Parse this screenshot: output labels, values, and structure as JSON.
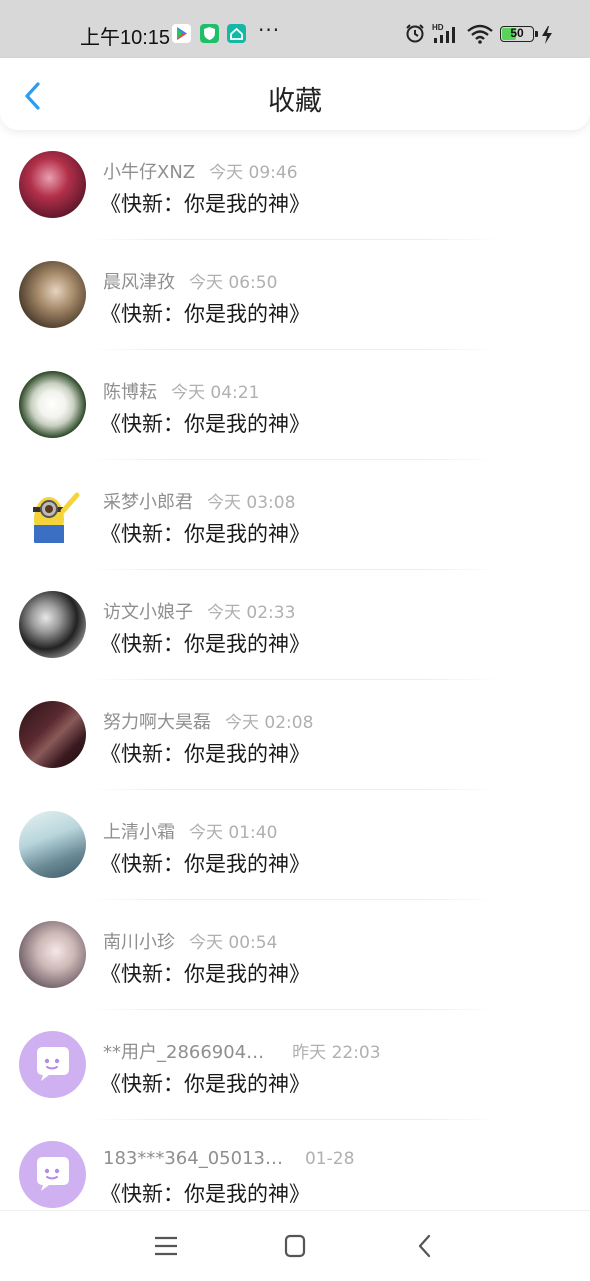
{
  "status_bar": {
    "time": "上午10:15",
    "more_dots": "···",
    "battery_level": "50",
    "battery_percent": 50
  },
  "header": {
    "title": "收藏",
    "back_icon": "chevron-left-icon"
  },
  "favorites": [
    {
      "user": "小牛仔XNZ",
      "time": "今天 09:46",
      "content": "《快新：你是我的神》",
      "avatar": "avatar-photo-red"
    },
    {
      "user": "晨风津孜",
      "time": "今天 06:50",
      "content": "《快新：你是我的神》",
      "avatar": "avatar-photo-girl"
    },
    {
      "user": "陈博耘",
      "time": "今天 04:21",
      "content": "《快新：你是我的神》",
      "avatar": "avatar-photo-flower"
    },
    {
      "user": "采梦小郎君",
      "time": "今天 03:08",
      "content": "《快新：你是我的神》",
      "avatar": "avatar-photo-minion"
    },
    {
      "user": "访文小娘子",
      "time": "今天 02:33",
      "content": "《快新：你是我的神》",
      "avatar": "avatar-photo-bw"
    },
    {
      "user": "努力啊大昊磊",
      "time": "今天 02:08",
      "content": "《快新：你是我的神》",
      "avatar": "avatar-photo-dark"
    },
    {
      "user": "上清小霜",
      "time": "今天 01:40",
      "content": "《快新：你是我的神》",
      "avatar": "avatar-photo-sky"
    },
    {
      "user": "南川小珍",
      "time": "今天 00:54",
      "content": "《快新：你是我的神》",
      "avatar": "avatar-photo-face"
    },
    {
      "user": "**用户_2866904…",
      "time": "昨天 22:03",
      "content": "《快新：你是我的神》",
      "avatar": "default-chat-avatar"
    },
    {
      "user": "183***364_05013…",
      "time": "01-28",
      "content": "《快新：你是我的神》",
      "avatar": "default-chat-avatar"
    }
  ],
  "nav_bar": {
    "menu_icon": "menu-icon",
    "home_icon": "home-square-icon",
    "back_icon": "back-triangle-icon"
  },
  "colors": {
    "accent": "#2a9df4",
    "status_bar_bg": "#d8d8d8",
    "default_avatar_bg": "#c6a6f0"
  }
}
